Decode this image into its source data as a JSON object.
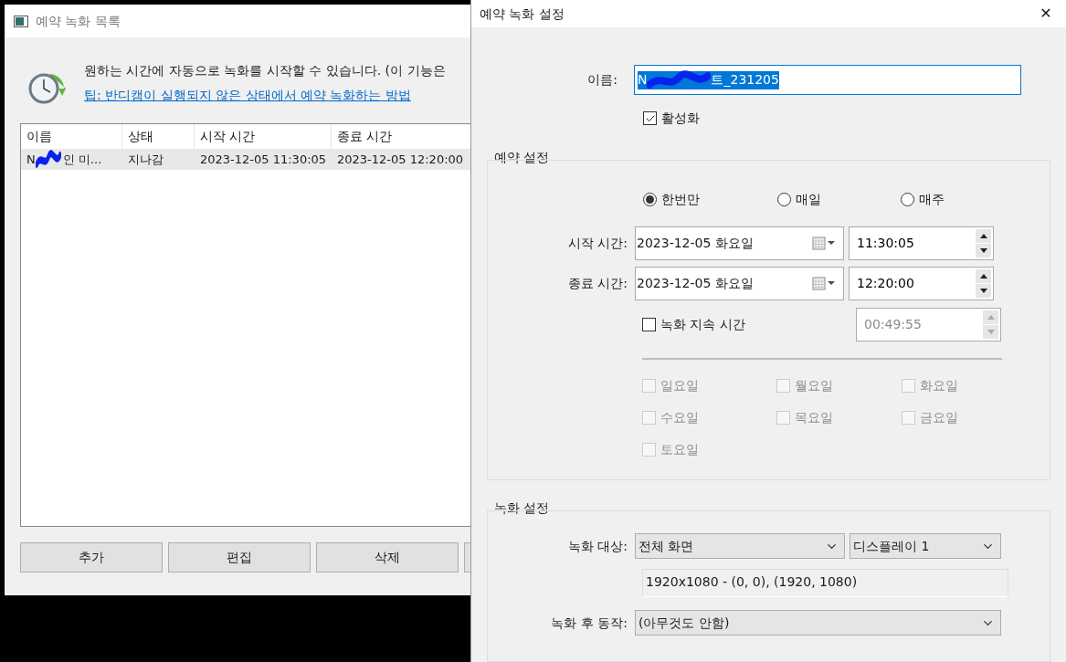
{
  "list_window": {
    "title": "예약 녹화 목록",
    "description": "원하는 시간에 자동으로 녹화를 시작할 수 있습니다. (이 기능은",
    "tip_link": "팁: 반디캠이 실행되지 않은 상태에서 예약 녹화하는 방법",
    "columns": [
      "이름",
      "상태",
      "시작 시간",
      "종료 시간"
    ],
    "rows": [
      {
        "name_prefix": "N",
        "name_suffix": "인 미...",
        "status": "지나감",
        "start": "2023-12-05 11:30:05",
        "end": "2023-12-05 12:20:00",
        "selected": true
      }
    ],
    "buttons": [
      "추가",
      "편집",
      "삭제"
    ]
  },
  "settings_dialog": {
    "title": "예약 녹화 설정",
    "close": "✕",
    "name": {
      "label": "이름:",
      "value_prefix": "N",
      "value_suffix": "트_231205"
    },
    "enabled": {
      "label": "활성화",
      "checked": true
    },
    "schedule": {
      "title": "예약 설정",
      "repeat": [
        {
          "label": "한번만",
          "selected": true
        },
        {
          "label": "매일",
          "selected": false
        },
        {
          "label": "매주",
          "selected": false
        }
      ],
      "start": {
        "label": "시작 시간:",
        "date": "2023-12-05 화요일",
        "time": "11:30:05"
      },
      "end": {
        "label": "종료 시간:",
        "date": "2023-12-05 화요일",
        "time": "12:20:00"
      },
      "duration": {
        "label": "녹화 지속 시간",
        "checked": false,
        "value": "00:49:55",
        "disabled": true
      },
      "weekdays": [
        {
          "label": "일요일",
          "checked": false,
          "disabled": true
        },
        {
          "label": "월요일",
          "checked": false,
          "disabled": true
        },
        {
          "label": "화요일",
          "checked": false,
          "disabled": true
        },
        {
          "label": "수요일",
          "checked": false,
          "disabled": true
        },
        {
          "label": "목요일",
          "checked": false,
          "disabled": true
        },
        {
          "label": "금요일",
          "checked": false,
          "disabled": true
        },
        {
          "label": "토요일",
          "checked": false,
          "disabled": true
        }
      ]
    },
    "recording": {
      "title": "녹화 설정",
      "target": {
        "label": "녹화 대상:",
        "mode": "전체 화면",
        "display": "디스플레이 1"
      },
      "area_info": "1920x1080 - (0, 0), (1920, 1080)",
      "after": {
        "label": "녹화 후 동작:",
        "value": "(아무것도 안함)"
      }
    }
  }
}
